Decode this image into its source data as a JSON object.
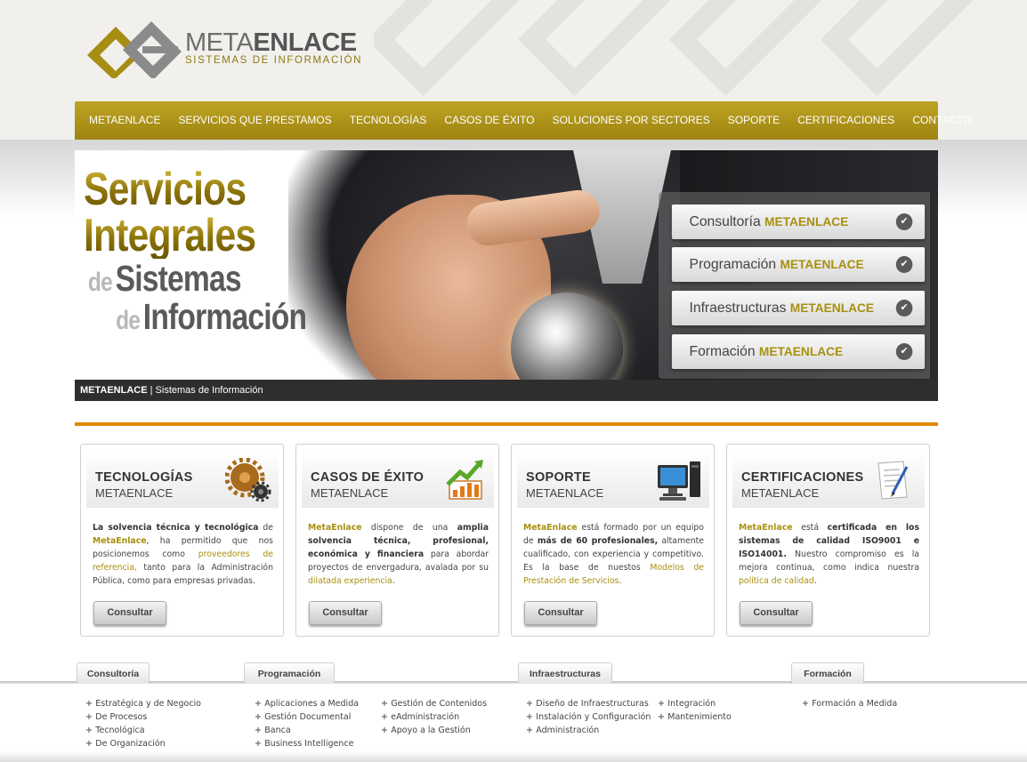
{
  "brand": {
    "name_light": "META",
    "name_bold": "ENLACE",
    "tagline": "SISTEMAS DE INFORMACIÓN"
  },
  "nav": {
    "items": [
      "METAENLACE",
      "SERVICIOS QUE PRESTAMOS",
      "TECNOLOGÍAS",
      "CASOS DE ÉXITO",
      "SOLUCIONES POR SECTORES",
      "SOPORTE",
      "CERTIFICACIONES",
      "CONTACTO"
    ]
  },
  "banner": {
    "line1": "Servicios",
    "line2": "Integrales",
    "line3_prefix": "de",
    "line3": "Sistemas",
    "line4_prefix": "de",
    "line4": "Información",
    "caption_bold": "METAENLACE",
    "caption_rest": " | Sistemas de Información",
    "services": [
      {
        "label": "Consultoría",
        "accent": "METAENLACE"
      },
      {
        "label": "Programación",
        "accent": "METAENLACE"
      },
      {
        "label": "Infraestructuras",
        "accent": "METAENLACE"
      },
      {
        "label": "Formación",
        "accent": "METAENLACE"
      }
    ]
  },
  "boxes": [
    {
      "title": "TECNOLOGÍAS",
      "subtitle": "METAENLACE",
      "icon": "gears-icon",
      "text": {
        "b1": "La solvencia técnica y tecnológica",
        "t1": " de ",
        "g1": "MetaEnlace",
        "t2": ", ha permitido que nos posicionemos como ",
        "link": "proveedores de referencia,",
        "t3": " tanto para la Administración Pública, como para empresas privadas."
      },
      "button": "Consultar"
    },
    {
      "title": "CASOS DE ÉXITO",
      "subtitle": "METAENLACE",
      "icon": "growth-chart-icon",
      "text": {
        "g1": "MetaEnlace",
        "t1": " dispone de una ",
        "b1": "amplia solvencia técnica, profesional, económica y financiera",
        "t2": " para abordar proyectos de envergadura, avalada por su ",
        "link": "dilatada experiencia",
        "t3": "."
      },
      "button": "Consultar"
    },
    {
      "title": "SOPORTE",
      "subtitle": "METAENLACE",
      "icon": "computer-icon",
      "text": {
        "g1": "MetaEnlace",
        "t1": " está formado por un equipo de ",
        "b1": "más de 60 profesionales,",
        "t2": " altamente cualificado, con experiencia y competitivo. Es la base de nuestos ",
        "link": "Modelos de Prestación de Servicios",
        "t3": "."
      },
      "button": "Consultar"
    },
    {
      "title": "CERTIFICACIONES",
      "subtitle": "METAENLACE",
      "icon": "certificate-icon",
      "text": {
        "g1": "MetaEnlace",
        "t1": " está ",
        "b1": "certificada en los sistemas de calidad ISO9001 e ISO14001.",
        "t2": " Nuestro compromiso es la mejora continua, como indica nuestra ",
        "link": "política de calidad",
        "t3": "."
      },
      "button": "Consultar"
    }
  ],
  "footer": {
    "tabs": [
      "Consultoría",
      "Programación",
      "Infraestructuras",
      "Formación"
    ],
    "consultoria": [
      "Estratégica y de Negocio",
      "De Procesos",
      "Tecnológica",
      "De Organización"
    ],
    "programacion_a": [
      "Aplicaciones a Medida",
      "Gestión Documental",
      "Banca",
      "Business Intelligence"
    ],
    "programacion_b": [
      "Gestión de Contenidos",
      "eAdministración",
      "Apoyo a la Gestión"
    ],
    "infra_a": [
      "Diseño de Infraestructuras",
      "Instalación y Configuración",
      "Administración"
    ],
    "infra_b": [
      "Integración",
      "Mantenimiento"
    ],
    "formacion": [
      "Formación a Medida"
    ]
  },
  "colors": {
    "accent_gold": "#a8900f",
    "nav_gold": "#b09619",
    "caption_orange": "#e08a00"
  }
}
